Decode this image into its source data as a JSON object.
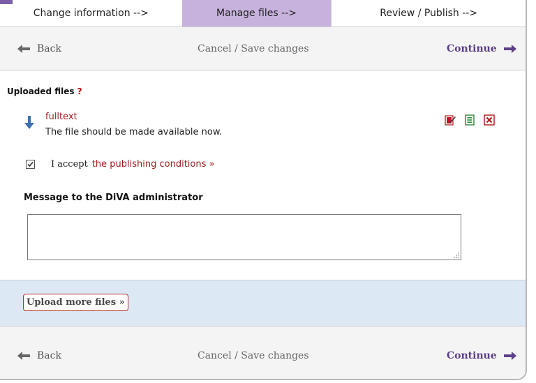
{
  "steps": [
    {
      "label": "Change information -->"
    },
    {
      "label": "Manage files -->",
      "active": true
    },
    {
      "label": "Review / Publish -->"
    }
  ],
  "nav": {
    "back_label": "Back",
    "save_label": "Cancel / Save changes",
    "continue_label": "Continue"
  },
  "uploaded_files": {
    "title": "Uploaded files",
    "help": "?",
    "file": {
      "name": "fulltext",
      "description": "The file should be made available now."
    },
    "tool_icons": [
      "edit-icon",
      "file-info-icon",
      "delete-icon"
    ]
  },
  "accept": {
    "checked": true,
    "text": "I accept",
    "link": "the publishing conditions »"
  },
  "message": {
    "label": "Message to the DiVA administrator",
    "value": ""
  },
  "upload_more_label": "Upload more files »",
  "colors": {
    "active_step": "#c6b2dc",
    "accent_purple": "#5d3f87",
    "link_red": "#9b1b1b",
    "upload_band": "#dde8f5"
  }
}
